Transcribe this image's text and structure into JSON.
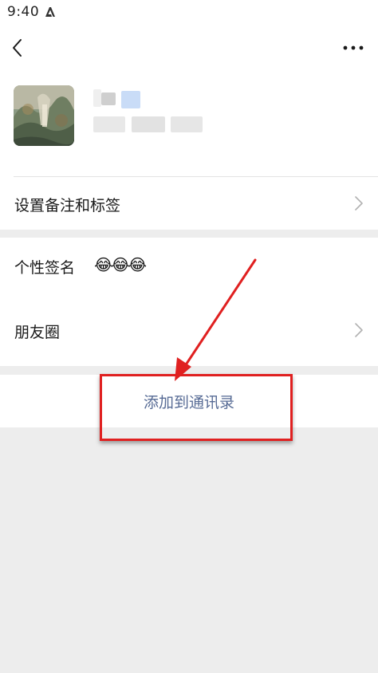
{
  "status_bar": {
    "time": "9:40",
    "notification_icon": "a-notification-icon"
  },
  "nav": {
    "back_icon": "chevron-left-icon",
    "more_icon": "more-dots-icon"
  },
  "profile": {
    "avatar": "landscape-painting-avatar"
  },
  "rows": {
    "remark_label": "设置备注和标签",
    "signature_label": "个性签名",
    "signature_value": "😂😂😂",
    "moments_label": "朋友圈"
  },
  "action": {
    "add_contact_label": "添加到通讯录",
    "color": "#576b95"
  },
  "annotation": {
    "color": "#e02020"
  }
}
